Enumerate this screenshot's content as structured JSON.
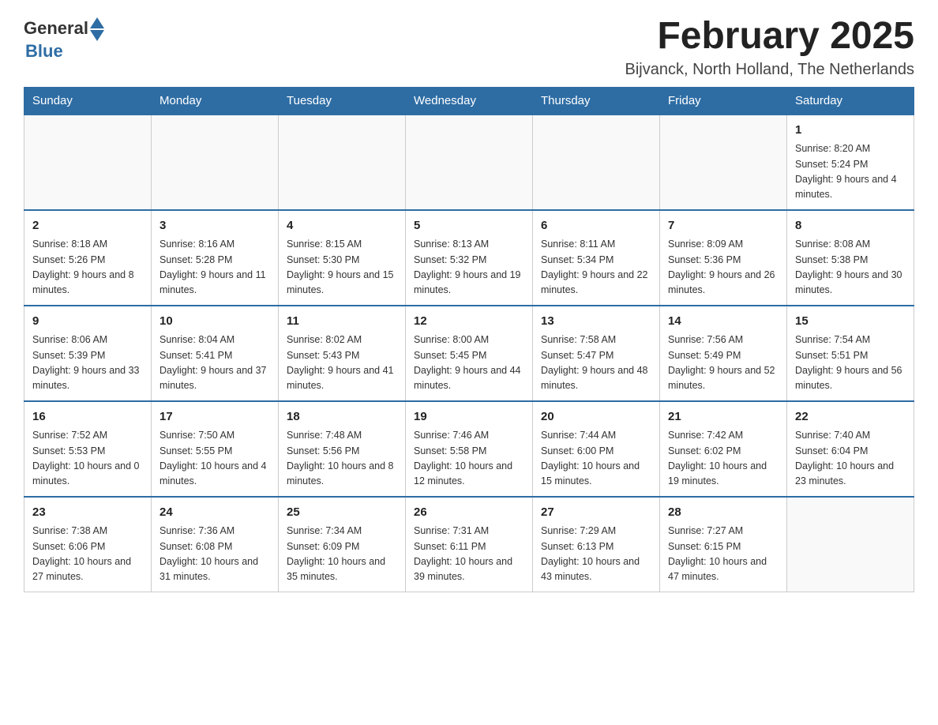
{
  "header": {
    "logo": {
      "text_general": "General",
      "text_blue": "Blue",
      "logo_combined": "GeneralBlue"
    },
    "title": "February 2025",
    "subtitle": "Bijvanck, North Holland, The Netherlands"
  },
  "weekdays": [
    "Sunday",
    "Monday",
    "Tuesday",
    "Wednesday",
    "Thursday",
    "Friday",
    "Saturday"
  ],
  "weeks": [
    [
      {
        "day": "",
        "info": ""
      },
      {
        "day": "",
        "info": ""
      },
      {
        "day": "",
        "info": ""
      },
      {
        "day": "",
        "info": ""
      },
      {
        "day": "",
        "info": ""
      },
      {
        "day": "",
        "info": ""
      },
      {
        "day": "1",
        "info": "Sunrise: 8:20 AM\nSunset: 5:24 PM\nDaylight: 9 hours and 4 minutes."
      }
    ],
    [
      {
        "day": "2",
        "info": "Sunrise: 8:18 AM\nSunset: 5:26 PM\nDaylight: 9 hours and 8 minutes."
      },
      {
        "day": "3",
        "info": "Sunrise: 8:16 AM\nSunset: 5:28 PM\nDaylight: 9 hours and 11 minutes."
      },
      {
        "day": "4",
        "info": "Sunrise: 8:15 AM\nSunset: 5:30 PM\nDaylight: 9 hours and 15 minutes."
      },
      {
        "day": "5",
        "info": "Sunrise: 8:13 AM\nSunset: 5:32 PM\nDaylight: 9 hours and 19 minutes."
      },
      {
        "day": "6",
        "info": "Sunrise: 8:11 AM\nSunset: 5:34 PM\nDaylight: 9 hours and 22 minutes."
      },
      {
        "day": "7",
        "info": "Sunrise: 8:09 AM\nSunset: 5:36 PM\nDaylight: 9 hours and 26 minutes."
      },
      {
        "day": "8",
        "info": "Sunrise: 8:08 AM\nSunset: 5:38 PM\nDaylight: 9 hours and 30 minutes."
      }
    ],
    [
      {
        "day": "9",
        "info": "Sunrise: 8:06 AM\nSunset: 5:39 PM\nDaylight: 9 hours and 33 minutes."
      },
      {
        "day": "10",
        "info": "Sunrise: 8:04 AM\nSunset: 5:41 PM\nDaylight: 9 hours and 37 minutes."
      },
      {
        "day": "11",
        "info": "Sunrise: 8:02 AM\nSunset: 5:43 PM\nDaylight: 9 hours and 41 minutes."
      },
      {
        "day": "12",
        "info": "Sunrise: 8:00 AM\nSunset: 5:45 PM\nDaylight: 9 hours and 44 minutes."
      },
      {
        "day": "13",
        "info": "Sunrise: 7:58 AM\nSunset: 5:47 PM\nDaylight: 9 hours and 48 minutes."
      },
      {
        "day": "14",
        "info": "Sunrise: 7:56 AM\nSunset: 5:49 PM\nDaylight: 9 hours and 52 minutes."
      },
      {
        "day": "15",
        "info": "Sunrise: 7:54 AM\nSunset: 5:51 PM\nDaylight: 9 hours and 56 minutes."
      }
    ],
    [
      {
        "day": "16",
        "info": "Sunrise: 7:52 AM\nSunset: 5:53 PM\nDaylight: 10 hours and 0 minutes."
      },
      {
        "day": "17",
        "info": "Sunrise: 7:50 AM\nSunset: 5:55 PM\nDaylight: 10 hours and 4 minutes."
      },
      {
        "day": "18",
        "info": "Sunrise: 7:48 AM\nSunset: 5:56 PM\nDaylight: 10 hours and 8 minutes."
      },
      {
        "day": "19",
        "info": "Sunrise: 7:46 AM\nSunset: 5:58 PM\nDaylight: 10 hours and 12 minutes."
      },
      {
        "day": "20",
        "info": "Sunrise: 7:44 AM\nSunset: 6:00 PM\nDaylight: 10 hours and 15 minutes."
      },
      {
        "day": "21",
        "info": "Sunrise: 7:42 AM\nSunset: 6:02 PM\nDaylight: 10 hours and 19 minutes."
      },
      {
        "day": "22",
        "info": "Sunrise: 7:40 AM\nSunset: 6:04 PM\nDaylight: 10 hours and 23 minutes."
      }
    ],
    [
      {
        "day": "23",
        "info": "Sunrise: 7:38 AM\nSunset: 6:06 PM\nDaylight: 10 hours and 27 minutes."
      },
      {
        "day": "24",
        "info": "Sunrise: 7:36 AM\nSunset: 6:08 PM\nDaylight: 10 hours and 31 minutes."
      },
      {
        "day": "25",
        "info": "Sunrise: 7:34 AM\nSunset: 6:09 PM\nDaylight: 10 hours and 35 minutes."
      },
      {
        "day": "26",
        "info": "Sunrise: 7:31 AM\nSunset: 6:11 PM\nDaylight: 10 hours and 39 minutes."
      },
      {
        "day": "27",
        "info": "Sunrise: 7:29 AM\nSunset: 6:13 PM\nDaylight: 10 hours and 43 minutes."
      },
      {
        "day": "28",
        "info": "Sunrise: 7:27 AM\nSunset: 6:15 PM\nDaylight: 10 hours and 47 minutes."
      },
      {
        "day": "",
        "info": ""
      }
    ]
  ]
}
